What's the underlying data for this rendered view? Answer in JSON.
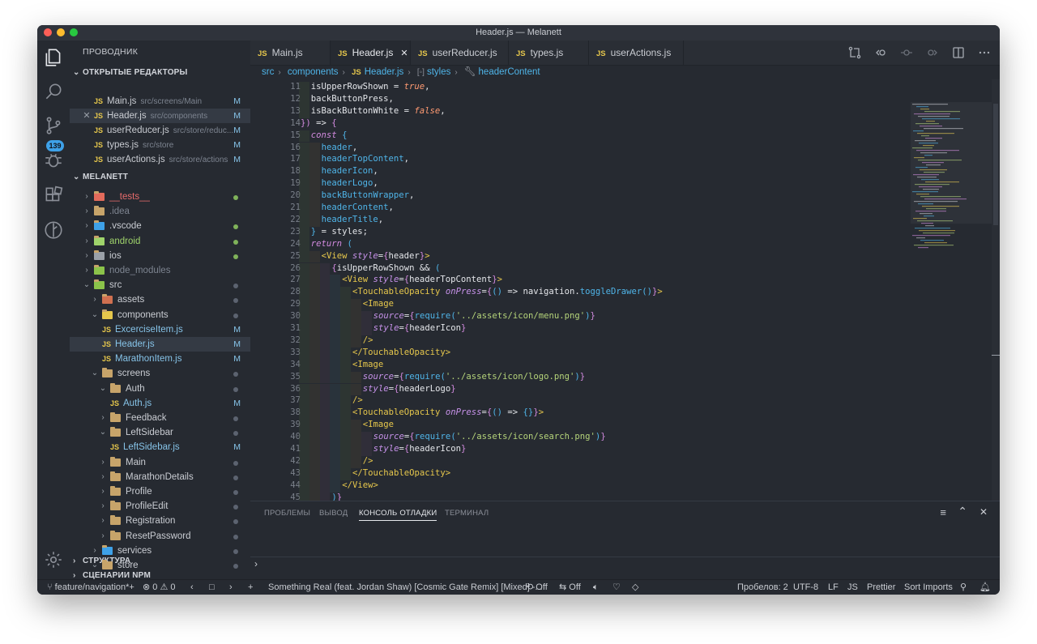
{
  "window": {
    "title": "Header.js — Melanett"
  },
  "activity": {
    "scm_badge": "139"
  },
  "sidebar": {
    "title": "ПРОВОДНИК",
    "open_editors_title": "ОТКРЫТЫЕ РЕДАКТОРЫ",
    "open_editors": [
      {
        "name": "Main.js",
        "path": "src/screens/Main",
        "status": "M"
      },
      {
        "name": "Header.js",
        "path": "src/components",
        "status": "M"
      },
      {
        "name": "userReducer.js",
        "path": "src/store/reduc...",
        "status": "M"
      },
      {
        "name": "types.js",
        "path": "src/store",
        "status": "M"
      },
      {
        "name": "userActions.js",
        "path": "src/store/actions",
        "status": "M"
      }
    ],
    "project_title": "MELANETT",
    "tree": [
      {
        "name": "__tests__",
        "status": ""
      },
      {
        "name": ".idea",
        "status": ""
      },
      {
        "name": ".vscode",
        "status": ""
      },
      {
        "name": "android",
        "status": ""
      },
      {
        "name": "ios",
        "status": ""
      },
      {
        "name": "node_modules",
        "status": ""
      },
      {
        "name": "src",
        "status": ""
      },
      {
        "name": "assets",
        "status": ""
      },
      {
        "name": "components",
        "status": ""
      },
      {
        "name": "ExcerciseItem.js",
        "status": "M"
      },
      {
        "name": "Header.js",
        "status": "M"
      },
      {
        "name": "MarathonItem.js",
        "status": "M"
      },
      {
        "name": "screens",
        "status": ""
      },
      {
        "name": "Auth",
        "status": ""
      },
      {
        "name": "Auth.js",
        "status": "M"
      },
      {
        "name": "Feedback",
        "status": ""
      },
      {
        "name": "LeftSidebar",
        "status": ""
      },
      {
        "name": "LeftSidebar.js",
        "status": "M"
      },
      {
        "name": "Main",
        "status": ""
      },
      {
        "name": "MarathonDetails",
        "status": ""
      },
      {
        "name": "Profile",
        "status": ""
      },
      {
        "name": "ProfileEdit",
        "status": ""
      },
      {
        "name": "Registration",
        "status": ""
      },
      {
        "name": "ResetPassword",
        "status": ""
      },
      {
        "name": "services",
        "status": ""
      },
      {
        "name": "store",
        "status": ""
      }
    ],
    "outline_title": "СТРУКТУРА",
    "npm_title": "СЦЕНАРИИ NPM"
  },
  "tabs": [
    {
      "js": "JS",
      "label": "Main.js"
    },
    {
      "js": "JS",
      "label": "Header.js",
      "close": "✕"
    },
    {
      "js": "JS",
      "label": "userReducer.js"
    },
    {
      "js": "JS",
      "label": "types.js"
    },
    {
      "js": "JS",
      "label": "userActions.js"
    }
  ],
  "breadcrumb": {
    "a": "src",
    "b": "components",
    "js": "JS",
    "c": "Header.js",
    "d": "styles",
    "e": "headerContent"
  },
  "editor": {
    "lines": [
      {
        "n": "11",
        "i": 1,
        "h": "<span class='vr' style='color:#e4e6ea'>isUpperRowShown</span> = <span class='bl'>true</span>,"
      },
      {
        "n": "12",
        "i": 1,
        "h": "backButtonPress,"
      },
      {
        "n": "13",
        "i": 1,
        "h": "isBackButtonWhite = <span class='bl'>false</span>,"
      },
      {
        "n": "14",
        "i": 0,
        "h": "<span class='br2'>})</span> => <span class='br2'>{</span>"
      },
      {
        "n": "15",
        "i": 1,
        "h": "<span class='kw'>const</span> <span class='br3'>{</span>"
      },
      {
        "n": "16",
        "i": 2,
        "h": "<span class='vr'>header</span>,"
      },
      {
        "n": "17",
        "i": 2,
        "h": "<span class='vr'>headerTopContent</span>,"
      },
      {
        "n": "18",
        "i": 2,
        "h": "<span class='vr'>headerIcon</span>,"
      },
      {
        "n": "19",
        "i": 2,
        "h": "<span class='vr'>headerLogo</span>,"
      },
      {
        "n": "20",
        "i": 2,
        "h": "<span class='vr'>backButtonWrapper</span>,"
      },
      {
        "n": "21",
        "i": 2,
        "h": "<span class='vr'>headerContent</span>,"
      },
      {
        "n": "22",
        "i": 2,
        "h": "<span class='vr'>headerTitle</span>,"
      },
      {
        "n": "23",
        "i": 1,
        "h": "<span class='br3'>}</span> = styles;"
      },
      {
        "n": "24",
        "i": 1,
        "h": "<span class='kw'>return</span> <span class='br3'>(</span>"
      },
      {
        "n": "25",
        "i": 2,
        "h": "<span class='tg'>&lt;View</span> <span class='at'>style</span>=<span class='br2'>{</span>header<span class='br2'>}</span><span class='tg'>&gt;</span>"
      },
      {
        "n": "26",
        "i": 3,
        "h": "<span class='br2'>{</span>isUpperRowShown &amp;&amp; <span class='br3'>(</span>"
      },
      {
        "n": "27",
        "i": 4,
        "h": "<span class='tg'>&lt;View</span> <span class='at'>style</span>=<span class='br2'>{</span>headerTopContent<span class='br2'>}</span><span class='tg'>&gt;</span>"
      },
      {
        "n": "28",
        "i": 5,
        "h": "<span class='tg'>&lt;TouchableOpacity</span> <span class='at'>onPress</span>=<span class='br2'>{</span><span class='br3'>()</span> =&gt; navigation.<span class='vr'>toggleDrawer</span><span class='br3'>()</span><span class='br2'>}</span><span class='tg'>&gt;</span>"
      },
      {
        "n": "29",
        "i": 6,
        "h": "<span class='tg'>&lt;Image</span>"
      },
      {
        "n": "30",
        "i": 7,
        "h": "<span class='at'>source</span>=<span class='br2'>{</span><span class='vr'>require</span><span class='br3'>(</span><span class='str'>'../assets/icon/menu.png'</span><span class='br3'>)</span><span class='br2'>}</span>"
      },
      {
        "n": "31",
        "i": 7,
        "h": "<span class='at'>style</span>=<span class='br2'>{</span>headerIcon<span class='br2'>}</span>"
      },
      {
        "n": "32",
        "i": 6,
        "h": "<span class='tg'>/&gt;</span>"
      },
      {
        "n": "33",
        "i": 5,
        "h": "<span class='tg'>&lt;/TouchableOpacity&gt;</span>"
      },
      {
        "n": "34",
        "i": 5,
        "h": "<span class='tg'>&lt;Image</span>"
      },
      {
        "n": "35",
        "i": 6,
        "h": "<span class='at'>source</span>=<span class='br2'>{</span><span class='vr'>require</span><span class='br3'>(</span><span class='str'>'../assets/icon/logo.png'</span><span class='br3'>)</span><span class='br2'>}</span>"
      },
      {
        "n": "36",
        "i": 6,
        "h": "<span class='at'>style</span>=<span class='br2'>{</span>headerLogo<span class='br2'>}</span>"
      },
      {
        "n": "37",
        "i": 5,
        "h": "<span class='tg'>/&gt;</span>"
      },
      {
        "n": "38",
        "i": 5,
        "h": "<span class='tg'>&lt;TouchableOpacity</span> <span class='at'>onPress</span>=<span class='br2'>{</span><span class='br3'>()</span> =&gt; <span class='br3'>{}</span><span class='br2'>}</span><span class='tg'>&gt;</span>"
      },
      {
        "n": "39",
        "i": 6,
        "h": "<span class='tg'>&lt;Image</span>"
      },
      {
        "n": "40",
        "i": 7,
        "h": "<span class='at'>source</span>=<span class='br2'>{</span><span class='vr'>require</span><span class='br3'>(</span><span class='str'>'../assets/icon/search.png'</span><span class='br3'>)</span><span class='br2'>}</span>"
      },
      {
        "n": "41",
        "i": 7,
        "h": "<span class='at'>style</span>=<span class='br2'>{</span>headerIcon<span class='br2'>}</span>"
      },
      {
        "n": "42",
        "i": 6,
        "h": "<span class='tg'>/&gt;</span>"
      },
      {
        "n": "43",
        "i": 5,
        "h": "<span class='tg'>&lt;/TouchableOpacity&gt;</span>"
      },
      {
        "n": "44",
        "i": 4,
        "h": "<span class='tg'>&lt;/View&gt;</span>"
      },
      {
        "n": "45",
        "i": 3,
        "h": "<span class='br3'>)</span><span class='br2'>}</span>"
      }
    ]
  },
  "panel": {
    "tabs": [
      "ПРОБЛЕМЫ",
      "ВЫВОД",
      "КОНСОЛЬ ОТЛАДКИ",
      "ТЕРМИНАЛ"
    ],
    "prompt": "›"
  },
  "status": {
    "branch": "feature/navigation*+",
    "errors": "0",
    "warnings": "0",
    "track": "Something Real (feat. Jordan Shaw) [Cosmic Gate Remix] [Mixed] -...",
    "off1": "Off",
    "off2": "Off",
    "spaces": "Пробелов: 2",
    "encoding": "UTF-8",
    "eol": "LF",
    "lang": "JS",
    "prettier": "Prettier",
    "sort": "Sort Imports"
  },
  "colors": {
    "accent": "#4fb4e8",
    "background": "#262a31",
    "modified": "#86c3e8"
  }
}
